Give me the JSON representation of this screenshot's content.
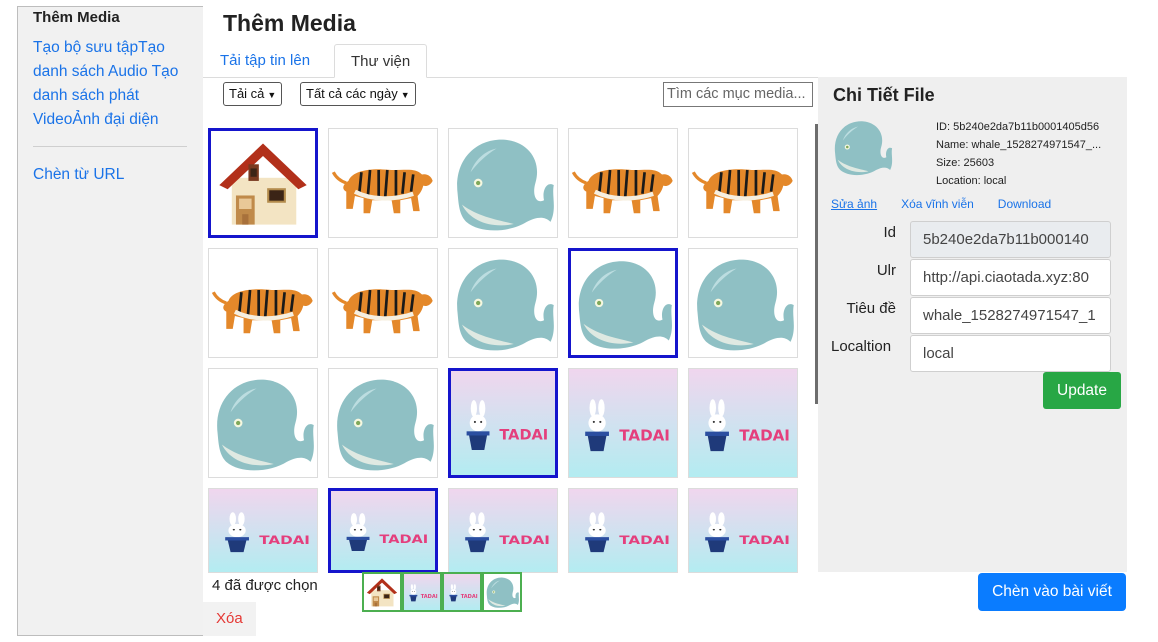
{
  "sidebar": {
    "title": "Thêm Media",
    "links": [
      "Tạo bộ sưu tập",
      "Tạo danh sách Audio",
      "Tạo danh sách phát Video",
      "Ảnh đại diện"
    ],
    "url_link": "Chèn từ URL"
  },
  "main": {
    "title": "Thêm Media",
    "tabs": [
      "Tải tập tin lên",
      "Thư viện"
    ],
    "active_tab": "Thư viện"
  },
  "filters": {
    "type": "Tải cả",
    "date": "Tất cả các ngày",
    "search_placeholder": "Tìm các mục media..."
  },
  "media_items": [
    {
      "icon": "house-icon",
      "selected": true
    },
    {
      "icon": "tiger-icon",
      "selected": false
    },
    {
      "icon": "whale-icon",
      "selected": false
    },
    {
      "icon": "tiger-icon",
      "selected": false
    },
    {
      "icon": "tiger-icon",
      "selected": false
    },
    {
      "icon": "tiger-icon",
      "selected": false
    },
    {
      "icon": "tiger-icon",
      "selected": false
    },
    {
      "icon": "whale-icon",
      "selected": false
    },
    {
      "icon": "whale-icon",
      "selected": true
    },
    {
      "icon": "whale-icon",
      "selected": false
    },
    {
      "icon": "whale-icon",
      "selected": false
    },
    {
      "icon": "whale-icon",
      "selected": false
    },
    {
      "icon": "tadai-icon",
      "selected": true
    },
    {
      "icon": "tadai-icon",
      "selected": false
    },
    {
      "icon": "tadai-icon",
      "selected": false
    },
    {
      "icon": "tadai-icon",
      "selected": false
    },
    {
      "icon": "tadai-icon",
      "selected": true
    },
    {
      "icon": "tadai-icon",
      "selected": false
    },
    {
      "icon": "tadai-icon",
      "selected": false
    },
    {
      "icon": "tadai-icon",
      "selected": false
    }
  ],
  "details": {
    "title": "Chi Tiết File",
    "meta": {
      "id": "ID: 5b240e2da7b11b0001405d56",
      "name": "Name: whale_1528274971547_...",
      "size": "Size: 25603",
      "location": "Location: local"
    },
    "actions": {
      "edit": "Sửa ảnh",
      "delete": "Xóa vĩnh viễn",
      "download": "Download"
    },
    "fields": {
      "id_label": "Id",
      "id_value": "5b240e2da7b11b000140",
      "url_label": "Ulr",
      "url_value": "http://api.ciaotada.xyz:80",
      "title_label": "Tiêu đề",
      "title_value": "whale_1528274971547_1",
      "location_label": "Localtion",
      "location_value": "local"
    },
    "update_button": "Update"
  },
  "footer": {
    "selected_count": "4 đã được chọn",
    "delete": "Xóa",
    "insert_button": "Chèn vào bài viết",
    "selected_thumbs": [
      "house-icon",
      "tadai-icon",
      "tadai-icon",
      "whale-icon"
    ]
  },
  "colors": {
    "link": "#1a73e8",
    "selection_border": "#1515cc",
    "update_button": "#28a745",
    "insert_button": "#0a7cff",
    "delete_text": "#e53935",
    "whale": "#8fc0c4"
  }
}
